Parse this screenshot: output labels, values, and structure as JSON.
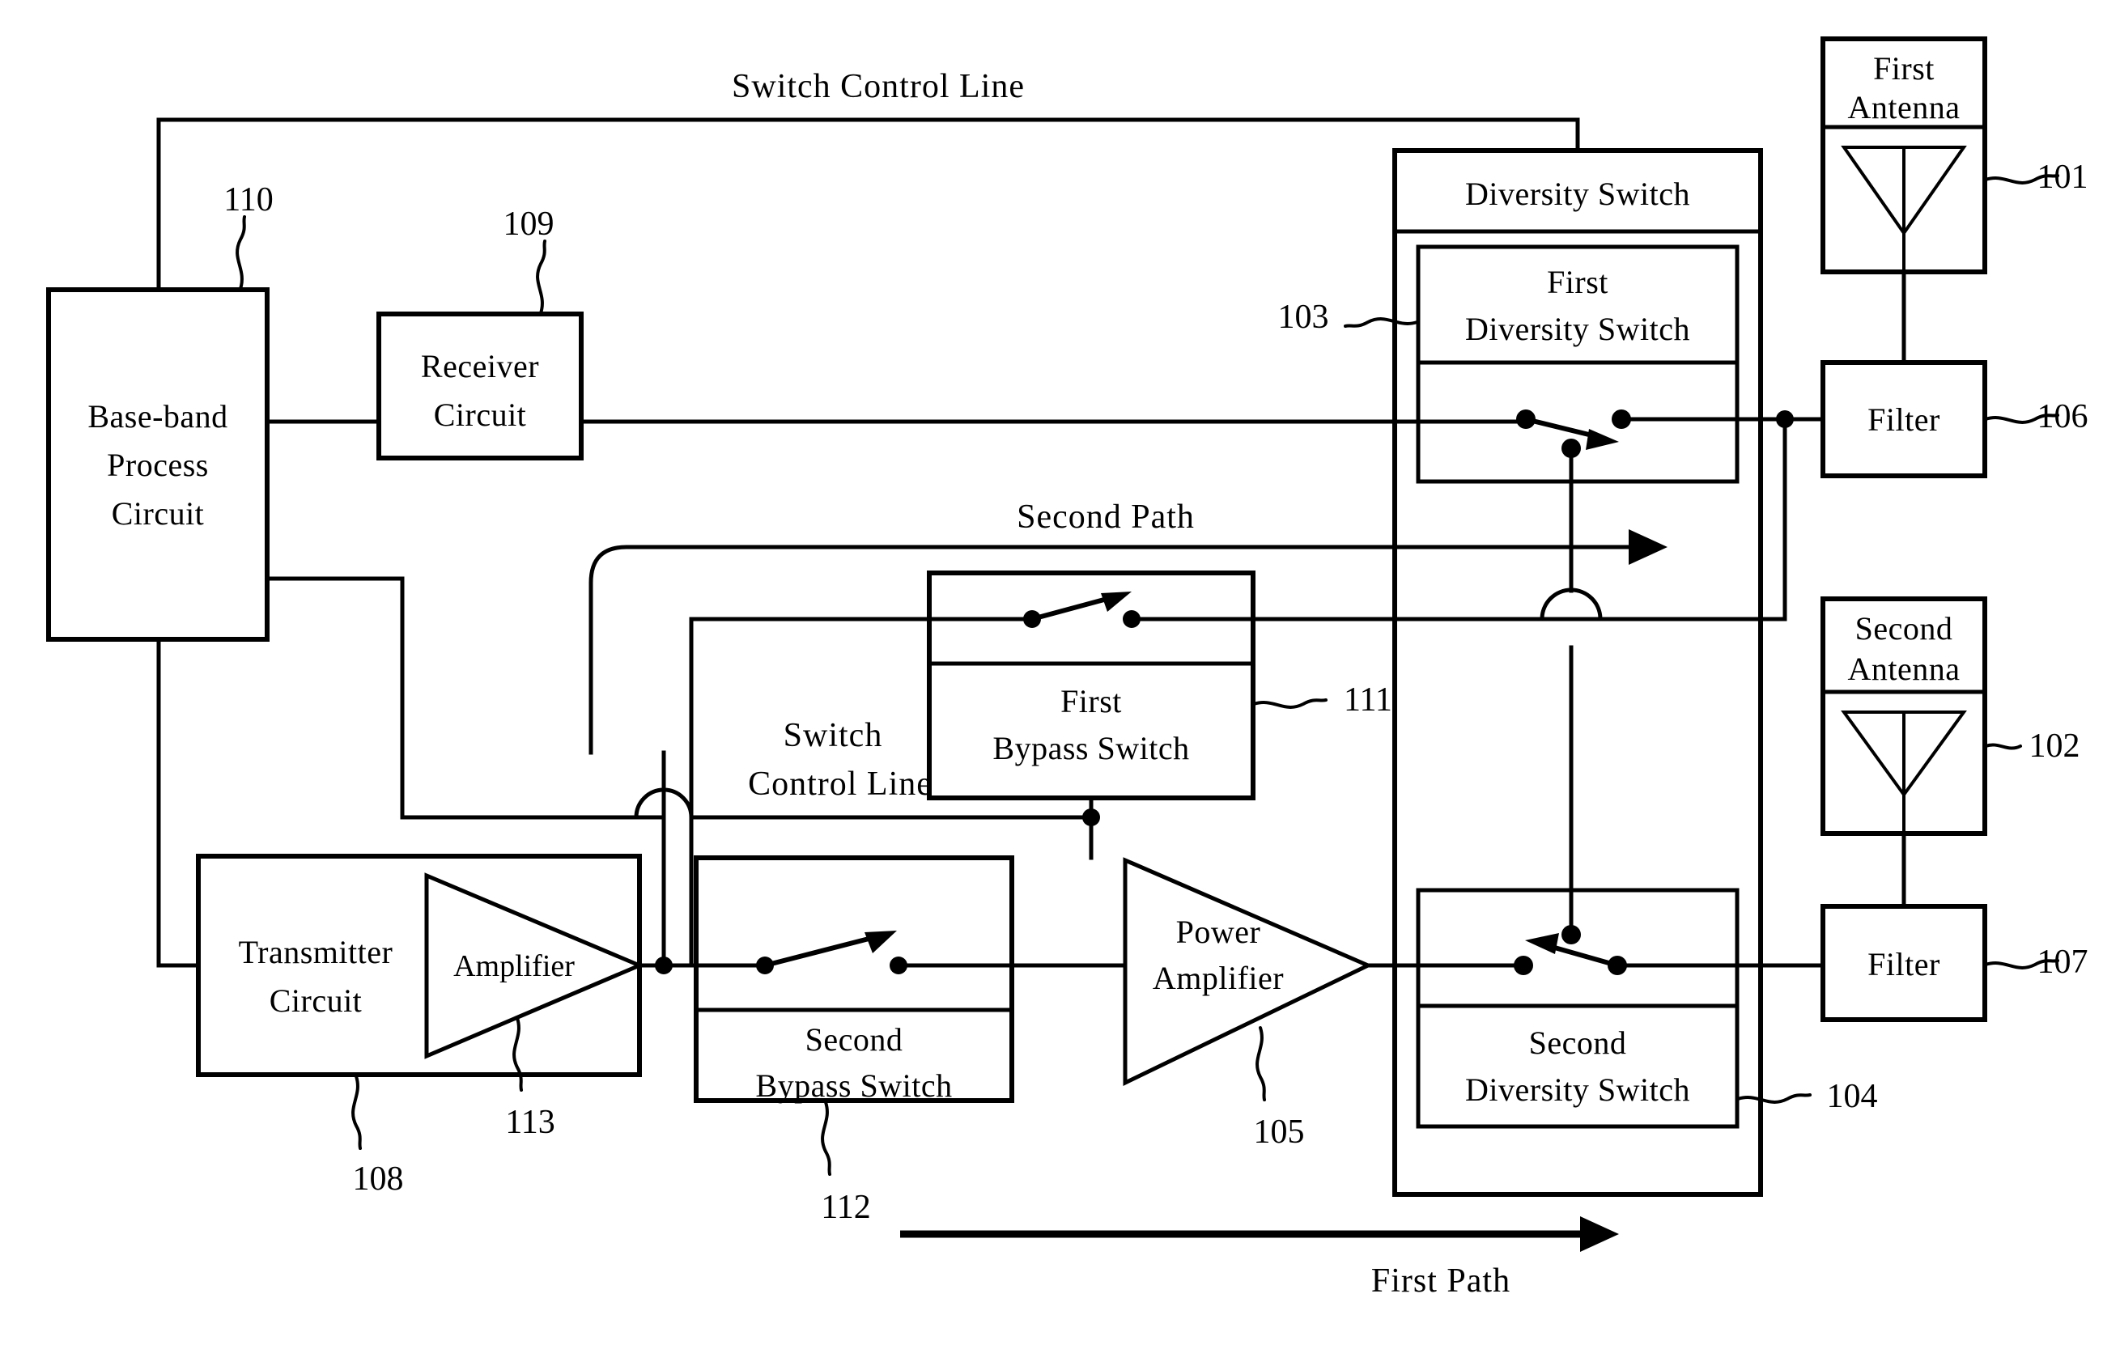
{
  "figure": {
    "type": "patent-block-diagram",
    "title_visible": false
  },
  "annotations": {
    "switch_control_line_top": "Switch Control Line",
    "switch_control_line_mid": "Switch\nControl Line",
    "switch_control_line_mid_line1": "Switch",
    "switch_control_line_mid_line2": "Control Line",
    "second_path": "Second Path",
    "first_path": "First Path"
  },
  "blocks": {
    "baseband": {
      "label_line1": "Base-band",
      "label_line2": "Process",
      "label_line3": "Circuit",
      "ref": "110"
    },
    "receiver": {
      "label_line1": "Receiver",
      "label_line2": "Circuit",
      "ref": "109"
    },
    "transmitter": {
      "label_line1": "Transmitter",
      "label_line2": "Circuit",
      "ref": "108"
    },
    "amplifier": {
      "label": "Amplifier",
      "ref": "113"
    },
    "power_amplifier": {
      "label_line1": "Power",
      "label_line2": "Amplifier",
      "ref": "105"
    },
    "diversity_switch": {
      "label": "Diversity Switch"
    },
    "first_diversity_switch": {
      "label_line1": "First",
      "label_line2": "Diversity Switch",
      "ref": "103"
    },
    "second_diversity_switch": {
      "label_line1": "Second",
      "label_line2": "Diversity Switch",
      "ref": "104"
    },
    "first_bypass_switch": {
      "label_line1": "First",
      "label_line2": "Bypass Switch",
      "ref": "111"
    },
    "second_bypass_switch": {
      "label_line1": "Second",
      "label_line2": "Bypass Switch",
      "ref": "112"
    },
    "first_antenna": {
      "label_line1": "First",
      "label_line2": "Antenna",
      "ref": "101"
    },
    "second_antenna": {
      "label_line1": "Second",
      "label_line2": "Antenna",
      "ref": "102"
    },
    "first_filter": {
      "label": "Filter",
      "ref": "106"
    },
    "second_filter": {
      "label": "Filter",
      "ref": "107"
    }
  },
  "colors": {
    "ink": "#000000",
    "paper": "#ffffff"
  }
}
